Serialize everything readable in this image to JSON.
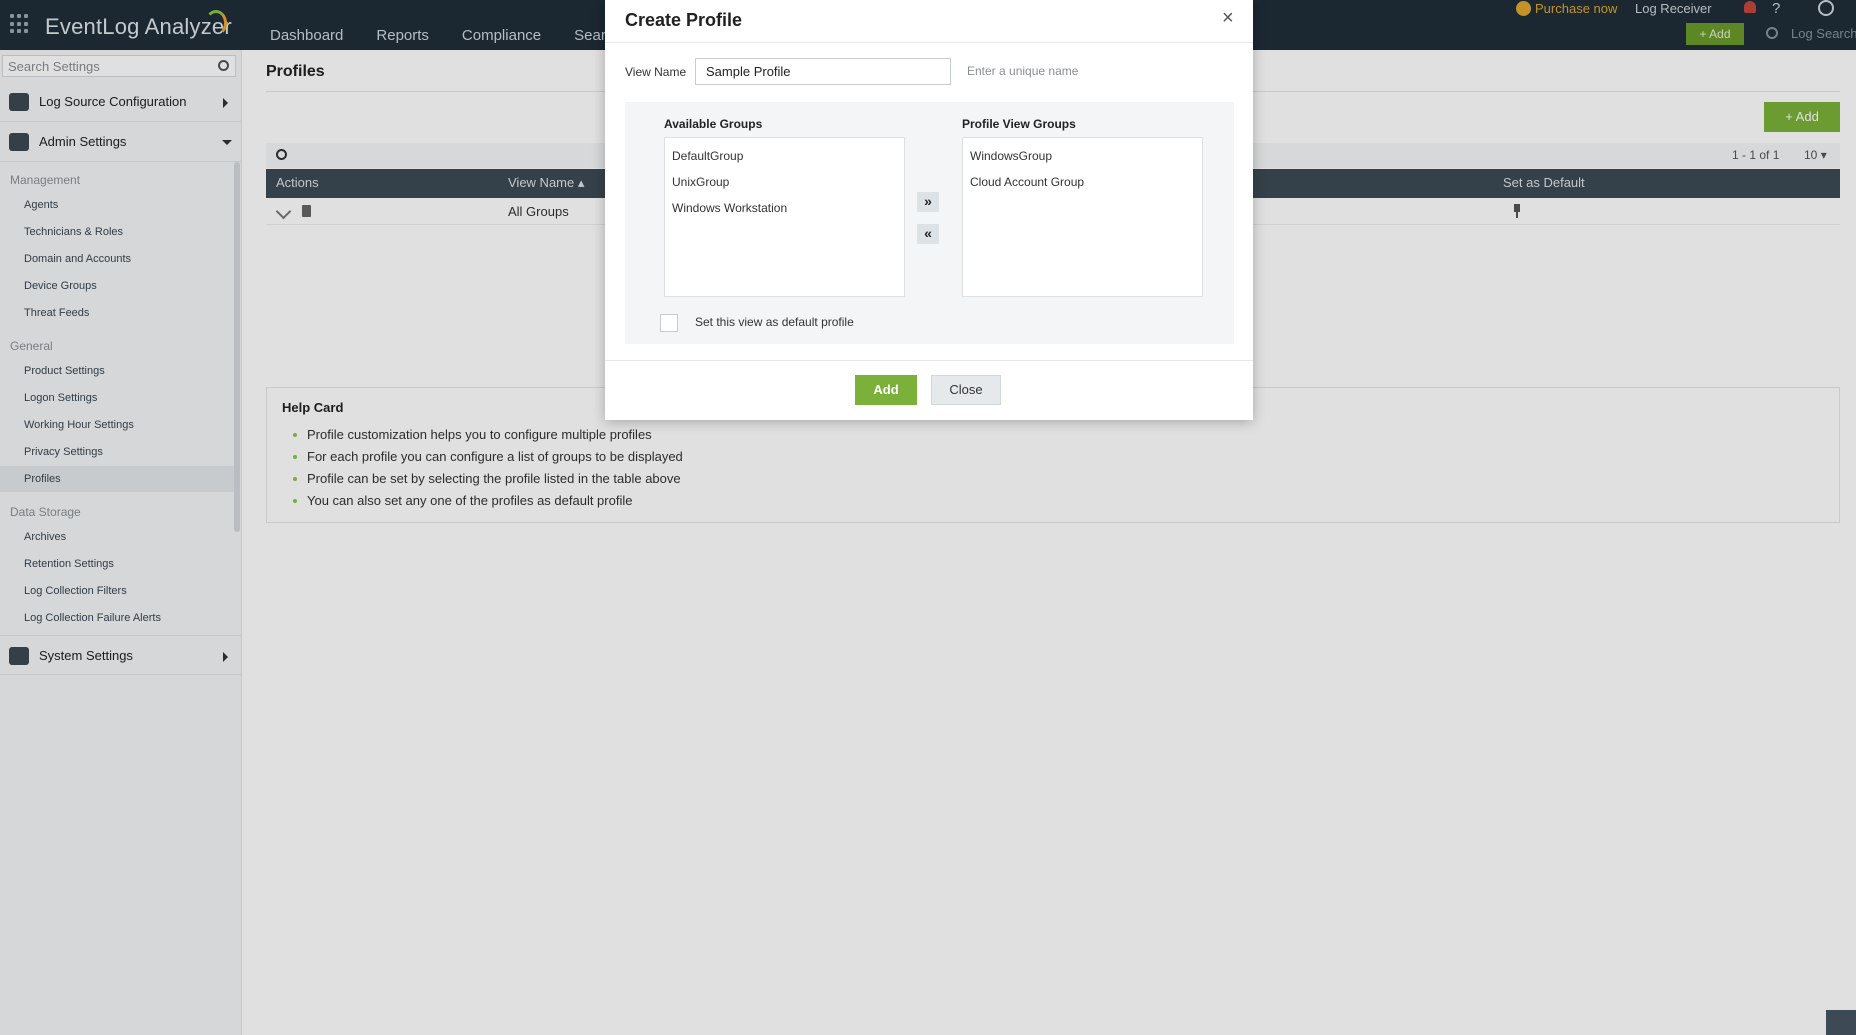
{
  "app": {
    "name": "EventLog Analyzer"
  },
  "nav": {
    "items": [
      "Dashboard",
      "Reports",
      "Compliance",
      "Search"
    ]
  },
  "topbar": {
    "purchase_label": "Purchase now",
    "log_receiver_label": "Log Receiver",
    "help_label": "?",
    "add_label": "+ Add",
    "log_search_label": "Log Search"
  },
  "sidebar": {
    "search_placeholder": "Search Settings",
    "sections": {
      "log_source": "Log Source Configuration",
      "admin": "Admin Settings",
      "system": "System Settings"
    },
    "groups": {
      "management": "Management",
      "general": "General",
      "data_storage": "Data Storage"
    },
    "management_items": [
      "Agents",
      "Technicians & Roles",
      "Domain and Accounts",
      "Device Groups",
      "Threat Feeds"
    ],
    "general_items": [
      "Product Settings",
      "Logon Settings",
      "Working Hour Settings",
      "Privacy Settings",
      "Profiles"
    ],
    "data_storage_items": [
      "Archives",
      "Retention Settings",
      "Log Collection Filters",
      "Log Collection Failure Alerts"
    ],
    "active_item": "Profiles"
  },
  "main": {
    "title": "Profiles",
    "add_label": "+ Add",
    "pager": "1 - 1 of 1",
    "page_size": "10",
    "columns": {
      "actions": "Actions",
      "view_name": "View Name",
      "set_default": "Set as Default"
    },
    "rows": [
      {
        "view_name": "All Groups"
      }
    ]
  },
  "help_card": {
    "title": "Help Card",
    "items": [
      "Profile customization helps you to configure multiple profiles",
      "For each profile you can configure a list of groups to be displayed",
      "Profile can be set by selecting the profile listed in the table above",
      "You can also set any one of the profiles as default profile"
    ]
  },
  "modal": {
    "title": "Create Profile",
    "close_symbol": "×",
    "view_name_label": "View Name",
    "view_name_value": "Sample Profile",
    "view_name_hint": "Enter a unique name",
    "available_title": "Available Groups",
    "available_groups": [
      "DefaultGroup",
      "UnixGroup",
      "Windows Workstation"
    ],
    "profile_title": "Profile View Groups",
    "profile_groups": [
      "WindowsGroup",
      "Cloud Account Group"
    ],
    "move_right": "»",
    "move_left": "«",
    "default_checkbox_label": "Set this view as default profile",
    "default_checked": false,
    "add_button": "Add",
    "close_button": "Close"
  },
  "colors": {
    "topbar": "#1f2d38",
    "accent_green": "#7bb13a",
    "table_header": "#3d4a55",
    "purchase": "#e0a82e"
  }
}
